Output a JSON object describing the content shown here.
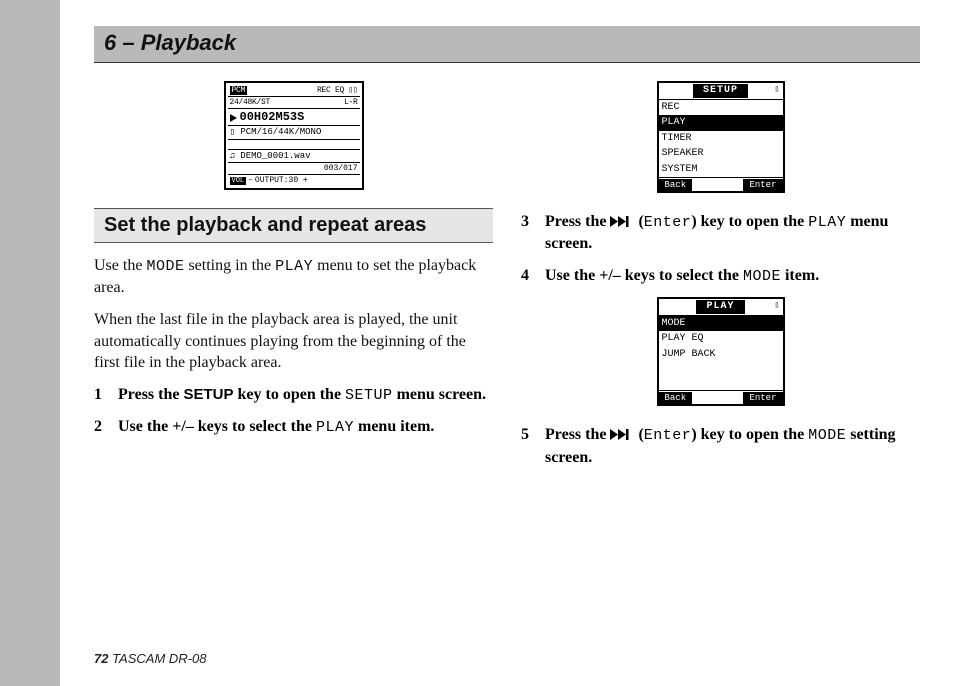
{
  "chapter": "6 – Playback",
  "lcd1": {
    "top_left": "PCM",
    "top_right": "REC EQ ▯▯",
    "fmt": "24/48K/ST",
    "lr": "L-R",
    "time": "00H02M53S",
    "codec": "PCM/16/44K/MONO",
    "file": "♫ DEMO_0001.wav",
    "counter": "003/017",
    "vol": "OUTPUT:30 +"
  },
  "section_title": "Set the playback and repeat areas",
  "para1_a": "Use the ",
  "para1_mode": "MODE",
  "para1_b": " setting in the ",
  "para1_play": "PLAY",
  "para1_c": " menu to set the playback area.",
  "para2": "When the last file in the playback area is played, the unit automatically continues playing from the beginning of the first file in the playback area.",
  "step1_a": "Press the ",
  "step1_setup_bold": "SETUP",
  "step1_b": " key to open the ",
  "step1_setup_mono": "SETUP",
  "step1_c": " menu screen.",
  "step2_a": "Use the +/– keys to select the ",
  "step2_play": "PLAY",
  "step2_b": " menu item.",
  "menu1": {
    "title": "SETUP",
    "items": [
      "REC",
      "PLAY",
      "TIMER",
      "SPEAKER",
      "SYSTEM"
    ],
    "selected_index": 1,
    "back": "Back",
    "enter": "Enter"
  },
  "step3_a": "Press the ",
  "step3_enter": "Enter",
  "step3_b": ") key to open the ",
  "step3_play": "PLAY",
  "step3_c": " menu screen.",
  "step4_a": "Use the +/– keys to select the ",
  "step4_mode": "MODE",
  "step4_b": " item.",
  "menu2": {
    "title": "PLAY",
    "items": [
      "MODE",
      "PLAY EQ",
      "JUMP BACK"
    ],
    "selected_index": 0,
    "back": "Back",
    "enter": "Enter"
  },
  "step5_a": "Press the ",
  "step5_enter": "Enter",
  "step5_b": ") key to open the ",
  "step5_mode": "MODE",
  "step5_c": " setting screen.",
  "footer_page": "72",
  "footer_text": " TASCAM  DR-08"
}
